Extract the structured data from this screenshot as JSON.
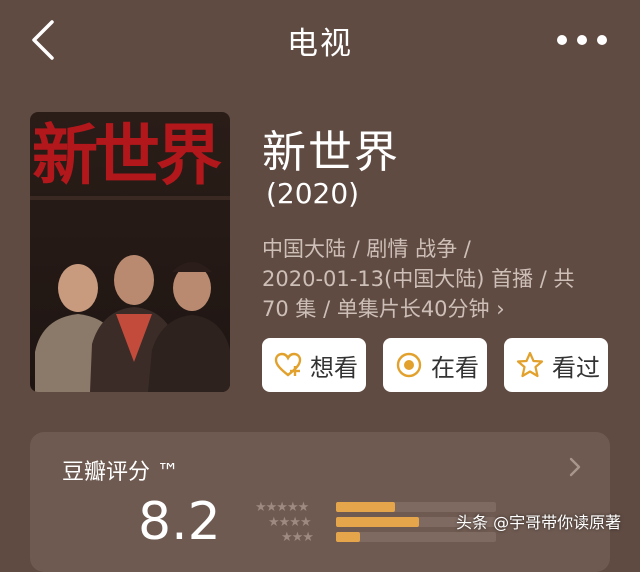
{
  "nav": {
    "title": "电视",
    "back_icon": "chevron-left-icon",
    "more_icon": "more-dots-icon"
  },
  "poster": {
    "title_text": "新世界"
  },
  "title": "新世界",
  "year": "(2020)",
  "meta": {
    "line1": "中国大陆 / 剧情 战争 /",
    "line2": "2020-01-13(中国大陆) 首播 / 共",
    "line3": "70 集 / 单集片长40分钟",
    "chevron": "›"
  },
  "actions": {
    "want": "想看",
    "watching": "在看",
    "watched": "看过"
  },
  "rating": {
    "label": "豆瓣评分 ™",
    "score": "8.2",
    "stars": [
      "★★★★★",
      "★★★★",
      "★★★"
    ],
    "distribution": [
      0.37,
      0.52,
      0.15
    ]
  },
  "watermark": "头条 @宇哥带你读原著",
  "colors": {
    "background": "#5f4b42",
    "accent": "#e5a54a",
    "button_icon": "#e2a12c"
  }
}
